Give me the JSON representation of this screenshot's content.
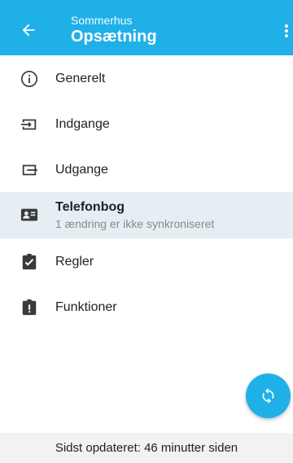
{
  "appbar": {
    "subtitle": "Sommerhus",
    "title": "Opsætning",
    "background_color": "#1fb0e8"
  },
  "menu": {
    "items": [
      {
        "label": "Generelt",
        "icon": "info-circle-icon"
      },
      {
        "label": "Indgange",
        "icon": "input-icon"
      },
      {
        "label": "Udgange",
        "icon": "output-icon"
      },
      {
        "label": "Telefonbog",
        "secondary": "1 ændring er ikke synkroniseret",
        "icon": "contact-card-icon",
        "selected": true
      },
      {
        "label": "Regler",
        "icon": "clipboard-check-icon"
      },
      {
        "label": "Funktioner",
        "icon": "clipboard-alert-icon"
      }
    ]
  },
  "fab": {
    "icon": "sync-icon"
  },
  "footer": {
    "status": "Sidst opdateret: 46 minutter siden"
  }
}
